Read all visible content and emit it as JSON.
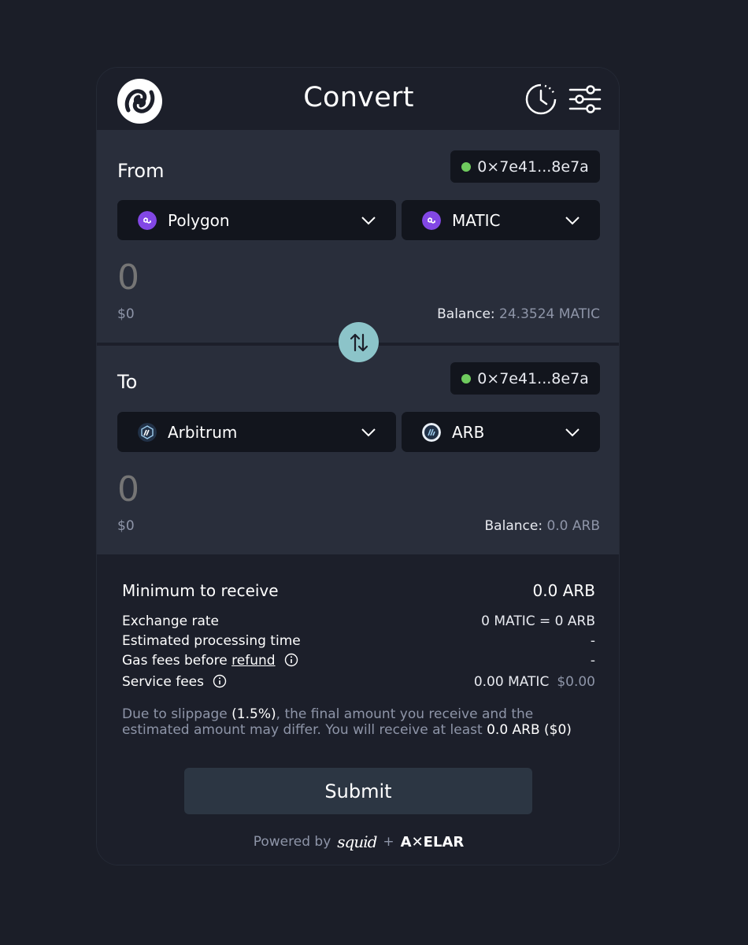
{
  "header": {
    "title": "Convert",
    "logo_icon": "squid-logo-icon",
    "history_icon": "history-clock-icon",
    "settings_icon": "sliders-settings-icon"
  },
  "from": {
    "label": "From",
    "address": "0×7e41...8e7a",
    "chain": "Polygon",
    "token": "MATIC",
    "amount_placeholder": "0",
    "usd": "$0",
    "balance_label": "Balance:",
    "balance_value": "24.3524 MATIC"
  },
  "to": {
    "label": "To",
    "address": "0×7e41...8e7a",
    "chain": "Arbitrum",
    "token": "ARB",
    "amount_placeholder": "0",
    "usd": "$0",
    "balance_label": "Balance:",
    "balance_value": "0.0 ARB"
  },
  "details": {
    "min_receive_label": "Minimum to receive",
    "min_receive_value": "0.0 ARB",
    "exchange_rate_label": "Exchange rate",
    "exchange_rate_value": "0 MATIC = 0 ARB",
    "processing_time_label": "Estimated processing time",
    "processing_time_value": "-",
    "gas_fees_label": "Gas fees before",
    "gas_fees_link": "refund",
    "gas_fees_value": "-",
    "service_fees_label": "Service fees",
    "service_fees_value": "0.00 MATIC",
    "service_fees_usd": "$0.00",
    "note_prefix": "Due to slippage",
    "note_slippage": "(1.5%)",
    "note_middle": ", the final amount you receive and the estimated amount may differ. You will receive at least",
    "note_amount": "0.0 ARB ($0)"
  },
  "submit_label": "Submit",
  "footer": {
    "powered_by": "Powered by",
    "brand_one": "squid",
    "plus": "+",
    "brand_two": "A✕ELAR"
  },
  "colors": {
    "background": "#1b1e28",
    "panel": "#292e3b",
    "select_bg": "#12151d",
    "swap_button": "#8cc4c9",
    "online_dot": "#6fcb5e",
    "polygon": "#8247e5",
    "arbitrum": "#213147",
    "submit_bg": "#2c3643"
  }
}
